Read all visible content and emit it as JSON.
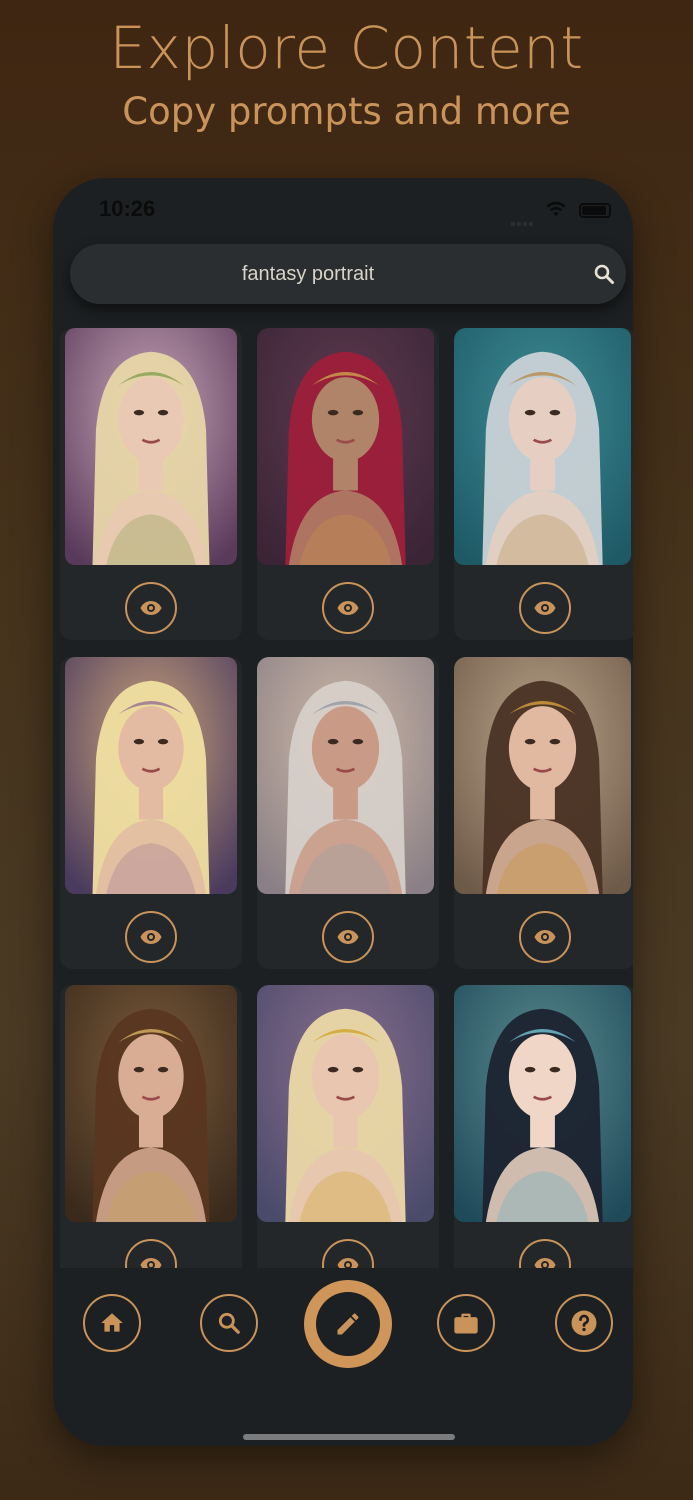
{
  "promo": {
    "title": "Explore Content",
    "subtitle": "Copy prompts and more"
  },
  "status_bar": {
    "time": "10:26"
  },
  "search": {
    "value": "fantasy portrait",
    "icon": "search-icon"
  },
  "results": [
    {
      "name": "result-card-1",
      "palette": {
        "bg1": "#5a3a5a",
        "bg2": "#c7a6b8",
        "hair": "#e8d6a8",
        "skin": "#e9c9b3",
        "accent": "#8fa45a"
      }
    },
    {
      "name": "result-card-2",
      "palette": {
        "bg1": "#3a2436",
        "bg2": "#5e3a4f",
        "hair": "#9e1f3a",
        "skin": "#b08468",
        "accent": "#c9954a"
      }
    },
    {
      "name": "result-card-3",
      "palette": {
        "bg1": "#1d5a66",
        "bg2": "#3e8b94",
        "hair": "#c9d2d6",
        "skin": "#e6cfc2",
        "accent": "#b8945a"
      }
    },
    {
      "name": "result-card-4",
      "palette": {
        "bg1": "#4a3a5e",
        "bg2": "#c9a27a",
        "hair": "#f0dfa0",
        "skin": "#e2bba2",
        "accent": "#a07a96"
      }
    },
    {
      "name": "result-card-5",
      "palette": {
        "bg1": "#8a7f86",
        "bg2": "#cdb9a6",
        "hair": "#d6cfc8",
        "skin": "#c99a86",
        "accent": "#9aa0a6"
      }
    },
    {
      "name": "result-card-6",
      "palette": {
        "bg1": "#6e5a48",
        "bg2": "#b8a48a",
        "hair": "#4a3324",
        "skin": "#e0b9a0",
        "accent": "#c9953a"
      }
    },
    {
      "name": "result-card-7",
      "palette": {
        "bg1": "#3a2a1c",
        "bg2": "#7a5a3a",
        "hair": "#5a3620",
        "skin": "#d8ad94",
        "accent": "#c9a35a"
      }
    },
    {
      "name": "result-card-8",
      "palette": {
        "bg1": "#4a4a6a",
        "bg2": "#8a6e8e",
        "hair": "#ecd9a6",
        "skin": "#e8c6b0",
        "accent": "#d4a83a"
      }
    },
    {
      "name": "result-card-9",
      "palette": {
        "bg1": "#1f4a5a",
        "bg2": "#5a8a8e",
        "hair": "#1c2330",
        "skin": "#f0d6c6",
        "accent": "#6ab4c0"
      }
    }
  ],
  "bottom_nav": {
    "items": [
      "home-icon",
      "search-icon",
      "pencil-icon",
      "briefcase-icon",
      "help-icon"
    ]
  },
  "colors": {
    "accent": "#c9935a",
    "panel": "#1d2022",
    "card": "#232729"
  }
}
